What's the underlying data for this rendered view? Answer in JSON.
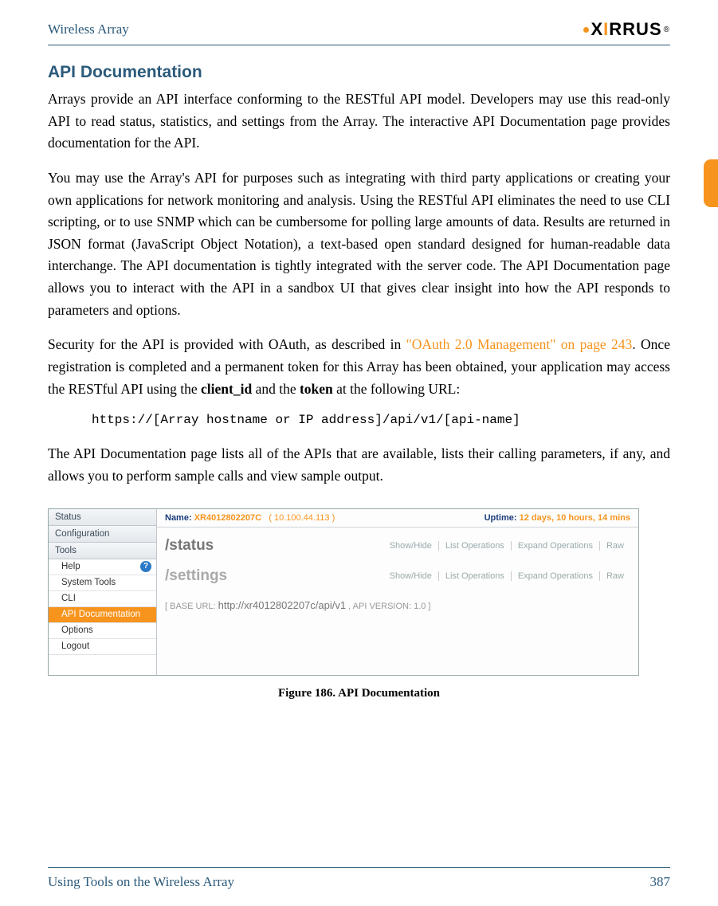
{
  "header": {
    "left": "Wireless Array",
    "logo_text": "XIRRUS"
  },
  "section_title": "API Documentation",
  "para1": "Arrays provide an API interface conforming to the RESTful API model. Developers may use this read-only API to read status, statistics, and settings from the Array. The interactive API Documentation page provides documentation for the API.",
  "para2": "You may use the Array's API for purposes such as integrating with third party applications or creating your own applications for network monitoring and analysis. Using the RESTful API eliminates the need to use CLI scripting, or to use SNMP which can be cumbersome for polling large amounts of data. Results are returned in JSON format (JavaScript Object Notation), a text-based open standard designed for human-readable data interchange. The API documentation is tightly integrated with the server code. The API Documentation page allows you to interact with the API in a sandbox UI that gives clear insight into how the API responds to parameters and options.",
  "para3_a": "Security for the API is provided with OAuth, as described in ",
  "para3_link": "\"OAuth 2.0 Management\" on page 243",
  "para3_b": ". Once registration is completed and a permanent token for this Array has been obtained, your application may access the RESTful API using the ",
  "para3_bold1": "client_id",
  "para3_c": " and the ",
  "para3_bold2": "token",
  "para3_d": " at the following URL:",
  "code": "https://[Array hostname or IP address]/api/v1/[api-name]",
  "para4": "The API Documentation page lists all of the APIs that are available, lists their calling parameters, if any, and allows you to perform sample calls and view sample output.",
  "figure": {
    "sidebar": {
      "sections": [
        "Status",
        "Configuration",
        "Tools"
      ],
      "items": [
        "Help",
        "System Tools",
        "CLI",
        "API Documentation",
        "Options",
        "Logout"
      ]
    },
    "topbar": {
      "name_label": "Name:",
      "name_value": "XR4012802207C",
      "ip": "( 10.100.44.113 )",
      "uptime_label": "Uptime:",
      "uptime_value": "12 days, 10 hours, 14 mins"
    },
    "paths": [
      "/status",
      "/settings"
    ],
    "ops": [
      "Show/Hide",
      "List Operations",
      "Expand Operations",
      "Raw"
    ],
    "baseurl_label_a": "[ BASE URL:",
    "baseurl_url": "http://xr4012802207c/api/v1",
    "baseurl_label_b": ", API VERSION: 1.0 ]"
  },
  "figure_caption": "Figure 186. API Documentation",
  "footer": {
    "left": "Using Tools on the Wireless Array",
    "right": "387"
  }
}
